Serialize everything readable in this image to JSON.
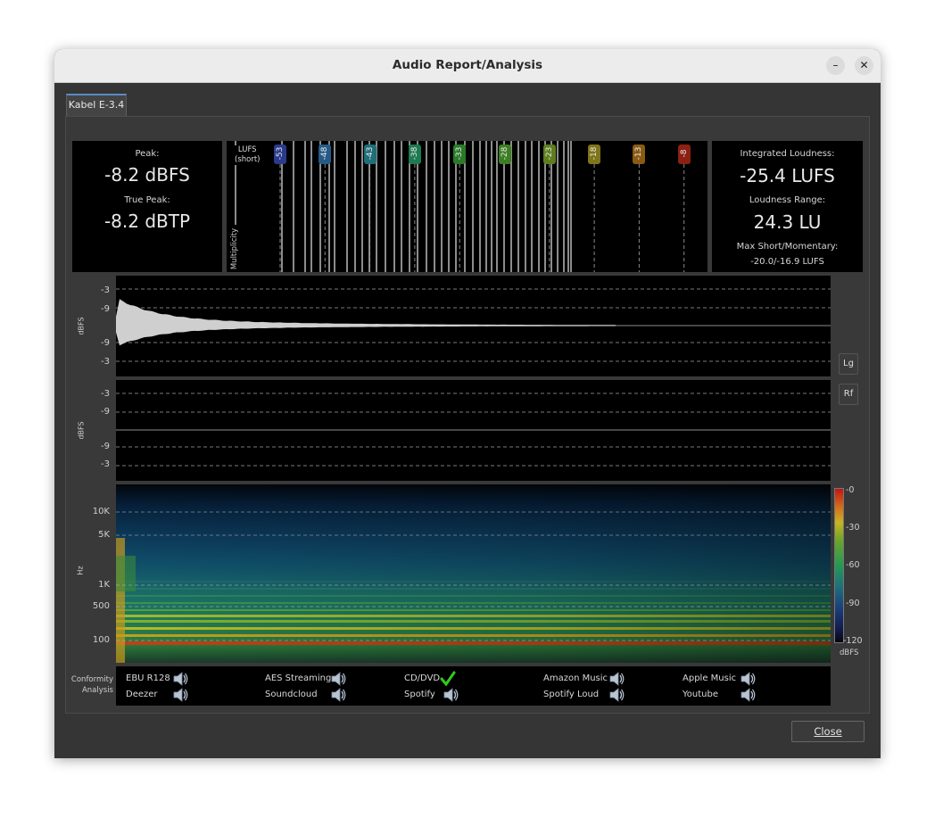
{
  "window": {
    "title": "Audio Report/Analysis",
    "minimize": "–",
    "close": "✕"
  },
  "tab": {
    "label": "Kabel E-3.4"
  },
  "peak": {
    "peak_label": "Peak:",
    "peak_value": "-8.2 dBFS",
    "true_peak_label": "True Peak:",
    "true_peak_value": "-8.2 dBTP"
  },
  "loudness": {
    "integrated_label": "Integrated Loudness:",
    "integrated_value": "-25.4 LUFS",
    "range_label": "Loudness Range:",
    "range_value": "24.3 LU",
    "max_label": "Max Short/Momentary:",
    "max_value": "-20.0/-16.9 LUFS"
  },
  "histogram": {
    "lufs_label": "LUFS",
    "short_label": "(short)",
    "multiplicity_label": "Multiplicity",
    "markers": [
      {
        "label": "-53",
        "color": "#2a3a8c"
      },
      {
        "label": "-48",
        "color": "#265a88"
      },
      {
        "label": "-43",
        "color": "#1f6e78"
      },
      {
        "label": "-38",
        "color": "#1e7a50"
      },
      {
        "label": "-33",
        "color": "#2a7a2a"
      },
      {
        "label": "-28",
        "color": "#3d7e22"
      },
      {
        "label": "-23",
        "color": "#5e7e1e"
      },
      {
        "label": "-18",
        "color": "#7e741a"
      },
      {
        "label": "-13",
        "color": "#8a5a14"
      },
      {
        "label": "-8",
        "color": "#8c2012"
      }
    ]
  },
  "waveform": {
    "unit_label": "dBFS",
    "ticks": [
      "-3",
      "-9",
      "-9",
      "-3"
    ]
  },
  "waveform2": {
    "unit_label": "dBFS",
    "ticks": [
      "-3",
      "-9",
      "-9",
      "-3"
    ]
  },
  "buttons": {
    "log": "Lg",
    "rectified": "Rf",
    "close_label": "Close"
  },
  "spectrogram": {
    "unit_label": "Hz",
    "ticks": [
      "10K",
      "5K",
      "1K",
      "500",
      "100"
    ],
    "scale_ticks": [
      "-0",
      "-30",
      "-60",
      "-90",
      "-120"
    ],
    "scale_unit": "dBFS"
  },
  "conformity": {
    "label_line1": "Conformity",
    "label_line2": "Analysis",
    "items": [
      {
        "name": "EBU R128",
        "status": "speaker"
      },
      {
        "name": "Deezer",
        "status": "speaker"
      },
      {
        "name": "AES Streaming",
        "status": "speaker"
      },
      {
        "name": "Soundcloud",
        "status": "speaker"
      },
      {
        "name": "CD/DVD",
        "status": "check"
      },
      {
        "name": "Spotify",
        "status": "speaker"
      },
      {
        "name": "Amazon Music",
        "status": "speaker"
      },
      {
        "name": "Spotify Loud",
        "status": "speaker"
      },
      {
        "name": "Apple Music",
        "status": "speaker"
      },
      {
        "name": "Youtube",
        "status": "speaker"
      }
    ]
  }
}
